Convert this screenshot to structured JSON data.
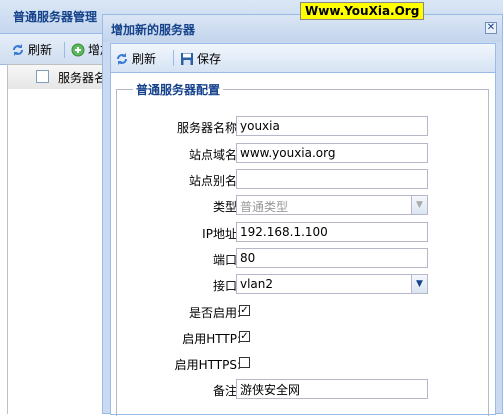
{
  "background": {
    "title": "普通服务器管理",
    "toolbar": {
      "refresh_label": "刷新",
      "add_label": "增加"
    },
    "grid": {
      "column_server_name": "服务器名"
    }
  },
  "window": {
    "title": "增加新的服务器",
    "watermark": "Www.YouXia.Org",
    "toolbar": {
      "refresh_label": "刷新",
      "save_label": "保存"
    },
    "fieldset_title": "普通服务器配置",
    "fields": {
      "server_name": {
        "label": "服务器名称:",
        "value": "youxia"
      },
      "site_domain": {
        "label": "站点域名:",
        "value": "www.youxia.org"
      },
      "site_alias": {
        "label": "站点别名:",
        "value": ""
      },
      "type": {
        "label": "类型:",
        "value": "普通类型"
      },
      "ip": {
        "label": "IP地址:",
        "value": "192.168.1.100"
      },
      "port": {
        "label": "端口:",
        "value": "80"
      },
      "interface": {
        "label": "接口:",
        "value": "vlan2"
      },
      "enabled": {
        "label": "是否启用:",
        "checked": true
      },
      "http": {
        "label": "启用HTTP:",
        "checked": true
      },
      "https": {
        "label": "启用HTTPS:",
        "checked": false
      },
      "note": {
        "label": "备注:",
        "value": "游侠安全网"
      }
    }
  },
  "colors": {
    "header_text": "#15428b",
    "border": "#99bbe8",
    "watermark_bg": "#ffff00"
  }
}
